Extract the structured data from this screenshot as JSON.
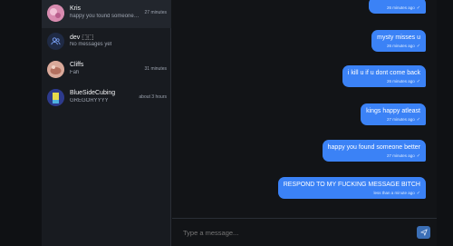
{
  "contacts": [
    {
      "name": "Kris",
      "preview": "happy you found someone b...",
      "time": "27 minutes",
      "active": true,
      "avatar_color": "#e8a0c0"
    },
    {
      "name": "dev ⬚⬚",
      "preview": "No messages yet",
      "time": "",
      "active": false,
      "avatar_icon": "users-icon"
    },
    {
      "name": "Cliffs",
      "preview": "Fah",
      "time": "31 minutes",
      "active": false,
      "avatar_color": "#c98a7a"
    },
    {
      "name": "BlueSideCubing",
      "preview": "GREGORYYYY",
      "time": "about 3 hours",
      "active": false,
      "avatar_color": "#2d3a8c"
    }
  ],
  "messages": [
    {
      "text": "",
      "meta": "26 minutes ago"
    },
    {
      "text": "mysty misses u",
      "meta": "26 minutes ago"
    },
    {
      "text": "i kill u if u dont come back",
      "meta": "26 minutes ago"
    },
    {
      "text": "kings happy atleast",
      "meta": "27 minutes ago"
    },
    {
      "text": "happy you found someone better",
      "meta": "27 minutes ago"
    },
    {
      "text": "RESPOND TO MY FUCKING MESSAGE BITCH",
      "meta": "less than a minute ago"
    }
  ],
  "composer": {
    "placeholder": "Type a message..."
  },
  "icons": {
    "read": "check-icon",
    "send": "send-icon"
  },
  "colors": {
    "bubble": "#3b82f6",
    "background": "#121417",
    "sidebar": "#181b20",
    "send_button": "#3b6fb6"
  }
}
